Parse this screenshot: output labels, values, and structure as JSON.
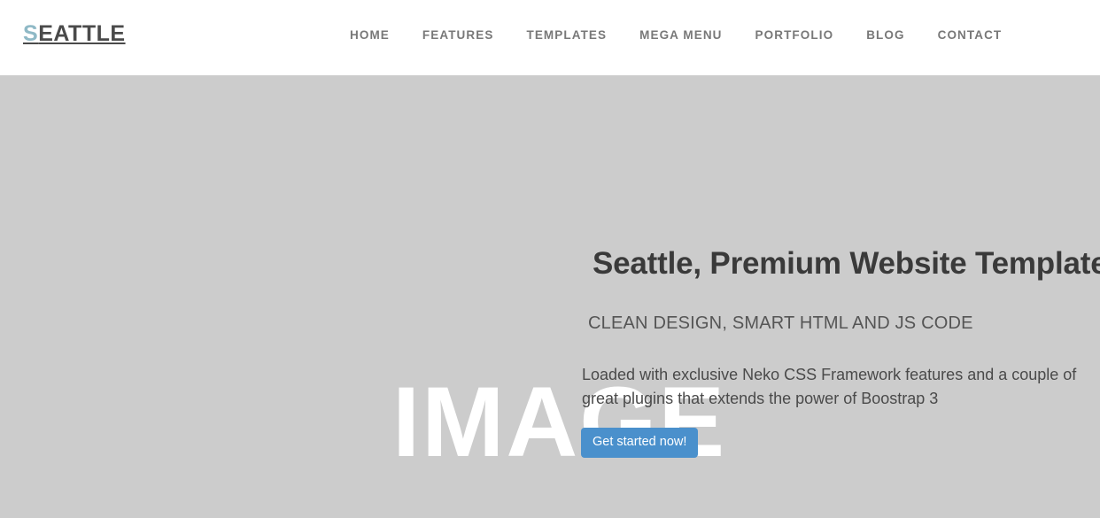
{
  "header": {
    "logo": {
      "accent_char": "S",
      "rest": "EATTLE",
      "accent_color": "#8fb9c6",
      "text_color": "#4a4a4a"
    },
    "nav": [
      {
        "label": "HOME"
      },
      {
        "label": "FEATURES"
      },
      {
        "label": "TEMPLATES"
      },
      {
        "label": "MEGA MENU"
      },
      {
        "label": "PORTFOLIO"
      },
      {
        "label": "BLOG"
      },
      {
        "label": "CONTACT"
      }
    ],
    "background_color": "#ffffff"
  },
  "hero": {
    "background_color": "#cccccc",
    "image_placeholder_label": "IMAGE",
    "title": "Seattle, Premium Website Template",
    "subtitle": "CLEAN DESIGN, SMART HTML AND JS CODE",
    "body": "Loaded with exclusive Neko CSS Framework features and a couple of great plugins that extends the power of Boostrap 3",
    "cta_label": "Get started now!",
    "cta_color": "#4a90cc",
    "title_color": "#3a3a3a",
    "subtitle_color": "#555555",
    "body_color": "#4a4a4a"
  }
}
